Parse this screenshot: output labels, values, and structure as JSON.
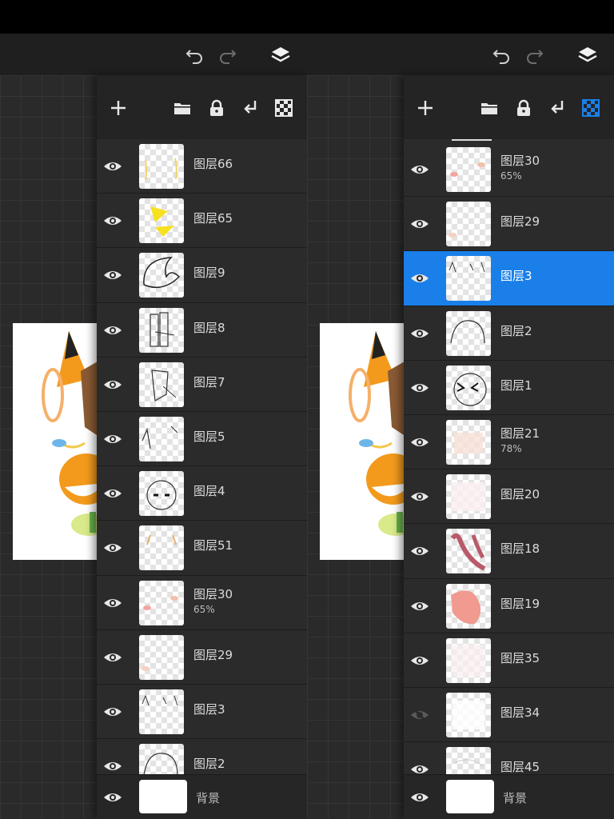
{
  "left_panel": {
    "layers": [
      {
        "name": "图层66",
        "opacity": "",
        "visible": true,
        "selected": false
      },
      {
        "name": "图层65",
        "opacity": "",
        "visible": true,
        "selected": false
      },
      {
        "name": "图层9",
        "opacity": "",
        "visible": true,
        "selected": false
      },
      {
        "name": "图层8",
        "opacity": "",
        "visible": true,
        "selected": false
      },
      {
        "name": "图层7",
        "opacity": "",
        "visible": true,
        "selected": false
      },
      {
        "name": "图层5",
        "opacity": "",
        "visible": true,
        "selected": false
      },
      {
        "name": "图层4",
        "opacity": "",
        "visible": true,
        "selected": false
      },
      {
        "name": "图层51",
        "opacity": "",
        "visible": true,
        "selected": false
      },
      {
        "name": "图层30",
        "opacity": "65%",
        "visible": true,
        "selected": false
      },
      {
        "name": "图层29",
        "opacity": "",
        "visible": true,
        "selected": false
      },
      {
        "name": "图层3",
        "opacity": "",
        "visible": true,
        "selected": false
      },
      {
        "name": "图层2",
        "opacity": "",
        "visible": true,
        "selected": false
      }
    ],
    "background": {
      "name": "背景"
    }
  },
  "right_panel": {
    "layers": [
      {
        "name": "图层30",
        "opacity": "65%",
        "visible": true,
        "selected": false
      },
      {
        "name": "图层29",
        "opacity": "",
        "visible": true,
        "selected": false
      },
      {
        "name": "图层3",
        "opacity": "",
        "visible": true,
        "selected": true
      },
      {
        "name": "图层2",
        "opacity": "",
        "visible": true,
        "selected": false
      },
      {
        "name": "图层1",
        "opacity": "",
        "visible": true,
        "selected": false
      },
      {
        "name": "图层21",
        "opacity": "78%",
        "visible": true,
        "selected": false
      },
      {
        "name": "图层20",
        "opacity": "",
        "visible": true,
        "selected": false
      },
      {
        "name": "图层18",
        "opacity": "",
        "visible": true,
        "selected": false
      },
      {
        "name": "图层19",
        "opacity": "",
        "visible": true,
        "selected": false
      },
      {
        "name": "图层35",
        "opacity": "",
        "visible": true,
        "selected": false
      },
      {
        "name": "图层34",
        "opacity": "",
        "visible": false,
        "selected": false
      },
      {
        "name": "图层45",
        "opacity": "",
        "visible": true,
        "selected": false
      }
    ],
    "background": {
      "name": "背景"
    }
  },
  "icons": {
    "undo": "undo-icon",
    "redo": "redo-icon",
    "layers": "layers-icon",
    "add": "plus-icon",
    "folder": "folder-icon",
    "lock": "lock-icon",
    "merge": "merge-down-icon",
    "alpha": "alpha-lock-icon",
    "eye": "eye-icon",
    "eye_hidden": "eye-hidden-icon"
  },
  "colors": {
    "selection": "#1a7fe8",
    "panel": "#2b2b2b",
    "alpha_active": "#1a7fe8"
  }
}
